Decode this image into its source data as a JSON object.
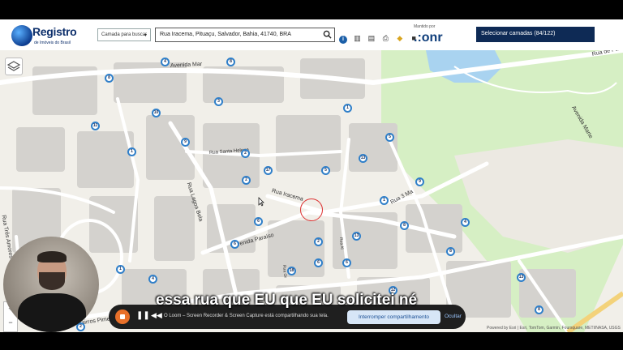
{
  "header": {
    "logo_title": "Registro",
    "logo_subtitle": "de Imóveis do Brasil",
    "layer_select_label": "Camada para buscar",
    "search_value": "Rua Iracema, Pituaçu, Salvador, Bahia, 41740, BRA",
    "sponsor_label": "Mantido por",
    "sponsor_name": ".:onr",
    "select_layers_label": "Selecionar camadas (84/122)"
  },
  "toolbar_icons": [
    "info-icon",
    "chart-icon",
    "document-icon",
    "print-icon",
    "layers-icon",
    "lock-icon"
  ],
  "map": {
    "road_labels": [
      "Avenida Mar",
      "Rua Santa Helena",
      "Rua Lagoa Bela",
      "Rua Iracema",
      "Rua 3 Ma",
      "Avenida Paraíso",
      "Rua Três Amores",
      "Rua Al",
      "Rua Or",
      "Avenida Marte",
      "Rua de Pa",
      "Bairros Pimentel"
    ],
    "markers": [
      "8",
      "4",
      "8",
      "10",
      "3",
      "1",
      "9",
      "11",
      "5",
      "2",
      "17",
      "1",
      "5",
      "13",
      "1",
      "2",
      "9",
      "6",
      "8",
      "4",
      "6",
      "13",
      "2",
      "6",
      "8",
      "1",
      "18",
      "12",
      "13",
      "4",
      "6",
      "2",
      "8"
    ],
    "attribution": "Powered by Esri | Esri, TomTom, Garmin, Foursquare, METI/NASA, USGS"
  },
  "recorder": {
    "status_text": "O Loom – Screen Recorder & Screen Capture está compartilhando sua tela.",
    "stop_share_label": "Interromper compartilhamento",
    "hide_label": "Ocultar"
  },
  "caption": "essa rua que EU que EU solicitei né",
  "colors": {
    "park_green": "#d6efc4",
    "water_blue": "#a9d3f0",
    "map_bg": "#f1efe9",
    "building": "#d4d2ce",
    "marker_border": "#2f7fc9",
    "primary_button": "#0e2a55",
    "recorder_button": "#e8702a"
  }
}
